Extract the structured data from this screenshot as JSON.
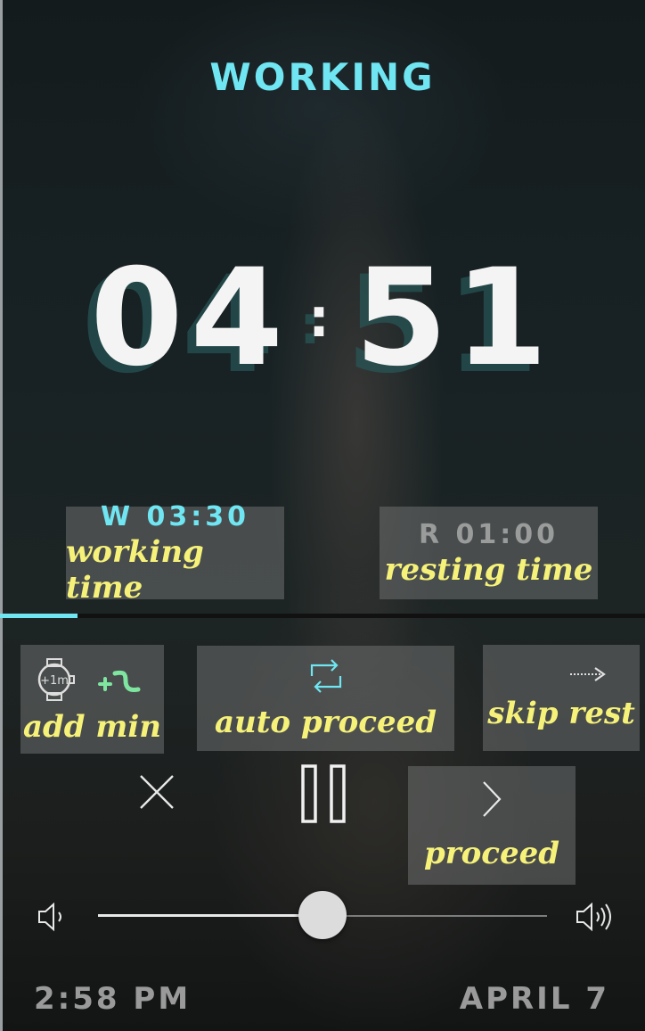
{
  "mode": {
    "title": "WORKING"
  },
  "timer": {
    "minutes": "04",
    "seconds": "51",
    "separator": ":"
  },
  "working": {
    "time": "W 03:30",
    "label": "working time"
  },
  "resting": {
    "time": "R 01:00",
    "label": "resting time"
  },
  "progress": {
    "fraction": 0.12,
    "color": "#6fe6f2"
  },
  "actions": {
    "add_min": {
      "label": "add min",
      "watch_text": "+1m"
    },
    "auto_proceed": {
      "label": "auto proceed"
    },
    "skip_rest": {
      "label": "skip rest"
    },
    "proceed": {
      "label": "proceed"
    }
  },
  "volume": {
    "level": 0.5
  },
  "footer": {
    "time": "2:58 PM",
    "date": "APRIL 7"
  },
  "colors": {
    "accent": "#6fe6f2",
    "label": "#f6f279",
    "panel": "rgba(110,112,112,0.55)"
  },
  "icons": [
    "close-icon",
    "pause-icon",
    "chevron-right-icon",
    "watch-icon",
    "plus-icon",
    "repeat-icon",
    "arrow-right-icon",
    "volume-low-icon",
    "volume-high-icon"
  ]
}
